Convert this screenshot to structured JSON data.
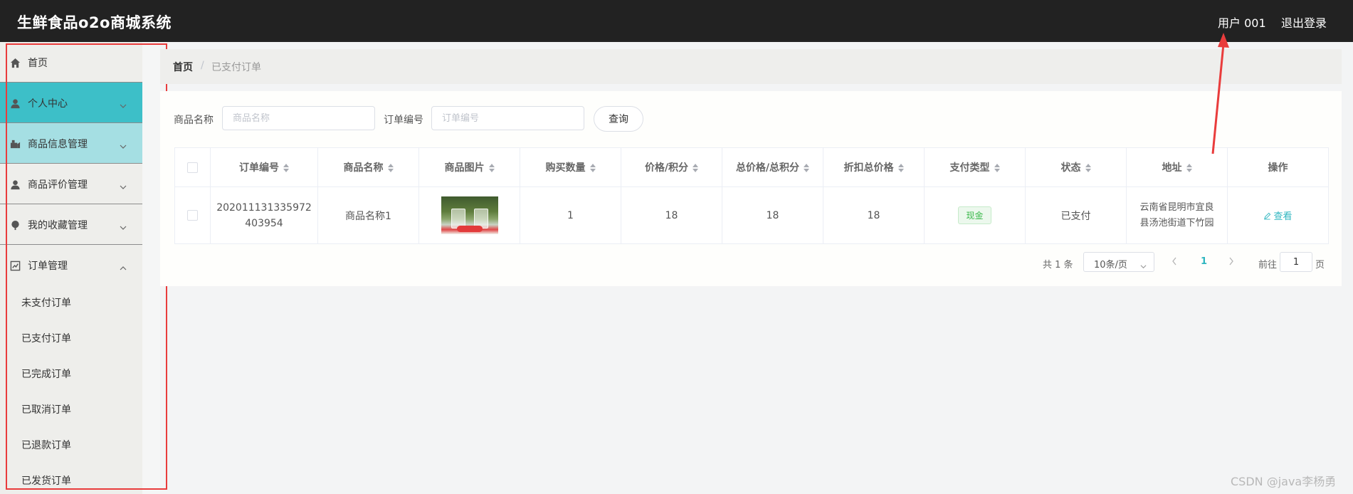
{
  "header": {
    "brand": "生鲜食品o2o商城系统",
    "user_label": "用户 001",
    "logout_label": "退出登录"
  },
  "sidebar": {
    "items": [
      {
        "label": "首页",
        "icon": "home-icon",
        "expandable": false
      },
      {
        "label": "个人中心",
        "icon": "user-icon",
        "expandable": true
      },
      {
        "label": "商品信息管理",
        "icon": "goods-icon",
        "expandable": true
      },
      {
        "label": "商品评价管理",
        "icon": "user-icon",
        "expandable": true
      },
      {
        "label": "我的收藏管理",
        "icon": "favorite-icon",
        "expandable": true
      },
      {
        "label": "订单管理",
        "icon": "order-icon",
        "expandable": true,
        "expanded": true
      }
    ],
    "sub_items": [
      "未支付订单",
      "已支付订单",
      "已完成订单",
      "已取消订单",
      "已退款订单",
      "已发货订单"
    ]
  },
  "breadcrumb": {
    "home": "首页",
    "separator": "/",
    "current": "已支付订单"
  },
  "search": {
    "product_name_label": "商品名称",
    "product_name_placeholder": "商品名称",
    "order_no_label": "订单编号",
    "order_no_placeholder": "订单编号",
    "query_button": "查询"
  },
  "table": {
    "columns": [
      "订单编号",
      "商品名称",
      "商品图片",
      "购买数量",
      "价格/积分",
      "总价格/总积分",
      "折扣总价格",
      "支付类型",
      "状态",
      "地址",
      "操作"
    ],
    "rows": [
      {
        "order_no": "202011131335972403954",
        "order_no_line1": "202011131335972",
        "order_no_line2": "403954",
        "product_name": "商品名称1",
        "quantity": "1",
        "price": "18",
        "total_price": "18",
        "discount_total": "18",
        "pay_type": "现金",
        "status": "已支付",
        "address": "云南省昆明市宜良县汤池街道下竹园",
        "address_line1": "云南省昆明市宜良",
        "address_line2": "县汤池街道下竹园",
        "action": "查看"
      }
    ]
  },
  "pagination": {
    "total_text": "共 1 条",
    "page_size": "10条/页",
    "current_page": "1",
    "goto_label": "前往",
    "goto_value": "1",
    "page_suffix": "页"
  },
  "watermark": "CSDN @java李杨勇",
  "colors": {
    "header_bg": "#222222",
    "accent": "#3dbfc8",
    "annotation": "#e93c3c"
  }
}
